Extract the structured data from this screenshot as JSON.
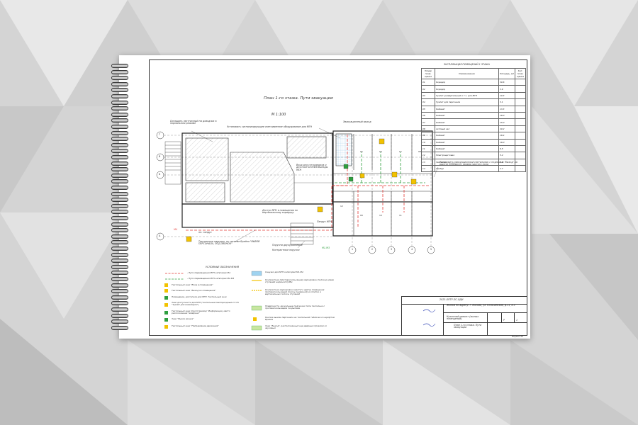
{
  "page_title": "План 1-го этажа. Пути эвакуации",
  "scale": "М 1:100",
  "explication": {
    "title": "ЭКСПЛИКАЦИЯ ПОМЕЩЕНИЙ 1 ЭТАЖА",
    "headers": [
      "Номер поме- щения",
      "Наименование",
      "Площадь, м2",
      "Кат. поме- щения"
    ],
    "rows": [
      [
        "01",
        "Коридор",
        "30.6",
        ""
      ],
      [
        "02",
        "Коридор",
        "3.9",
        ""
      ],
      [
        "03",
        "Туалет универсальный и т.ч. для МГН",
        "10.3",
        ""
      ],
      [
        "04",
        "Туалет для персонала",
        "3.1",
        ""
      ],
      [
        "05",
        "Кабинет",
        "13.3",
        ""
      ],
      [
        "06",
        "Кабинет",
        "16.0",
        ""
      ],
      [
        "07",
        "Кабинет",
        "15.0",
        ""
      ],
      [
        "08",
        "Актовый зал",
        "20.2",
        ""
      ],
      [
        "09",
        "Кабинет",
        "16.4",
        ""
      ],
      [
        "10",
        "Кабинет",
        "16.0",
        ""
      ],
      [
        "11",
        "Кабинет",
        "9.5",
        ""
      ],
      [
        "12",
        "Электрощитовая",
        "5.4",
        ""
      ],
      [
        "13",
        "Лестница",
        "8.5",
        ""
      ],
      [
        "14",
        "Тамбур",
        "2.7",
        ""
      ]
    ]
  },
  "annotations": {
    "door_note": "Оснащать лестничный на доводчик в нормальном режиме",
    "signal_note": "Установить сигнализирующее светоименное оборудование для МГН",
    "evac_exit": "Эвакуационный выход",
    "entrance_note": "Вход для сотрудников и для посетителей Выезды МГН",
    "right_note": "Установить эвакуационный светильник с подписью 'Выход' на высоте 2000мм от уровня чистого пола",
    "mgn_access": "Доступ МГН в помещения по вертикальному коридору",
    "ramp": "Пандус МГН",
    "tactile_1": "Тактильные надписи, по системе Брайля \"ВЫЗОВ ПЕРСОНАЛА, ПОД ЗВОНОК\"",
    "handrail": "Поручни двухуровневые",
    "handrail_2": "Контрастные поручни",
    "ramp_mark": "пп. пандус",
    "axis_letters": [
      "Г",
      "В",
      "Б",
      "А"
    ],
    "axis_numbers": [
      "1",
      "2",
      "3",
      "4",
      "5",
      "6"
    ],
    "route_label_red": "М4",
    "route_label_green": "М1-М3"
  },
  "legend": {
    "title": "УСЛОВНЫЕ ОБОЗНАЧЕНИЯ",
    "left": [
      "- Пути перемещения МГН категории М4",
      "- Пути перемещения МГН категории М1-М3",
      "Тактильный знак \"Вход в помещение\"",
      "Тактильный знак \"Выход из помещения\"",
      "Помещение, доступное для МГН. Тактильный знак",
      "Знак доступности для МГН (тактильный светодиодный 2.5 ГК \"Туалет для инвалидов\")",
      "Тактильный знак (пиктограмма) \"Информация, место расположения телефона\"",
      "Знак \"Вызов звонка\"",
      "Тактильный знак \"Направление движения\""
    ],
    "right": [
      "Санузел для МГН категорий М1-М4",
      "Контрастная (противоскользящая) маркировка (полосы) краев ступеней шириной 0,08м",
      "Контрастная маркировка (желтого цвета) помещения противоскользящей полосы (шириной) из плитки и вертикальных полосы ступеней",
      "Поверхности, визуальные подсказки типа тактильно с противоскользящим покрытием",
      "Кнопка вызова персонала на тактильной табличке со шрифтом Брайля",
      "Знак \"Выход\", расположенный над дверным проемом со звуковым"
    ]
  },
  "stamp": {
    "code": "2023-ОПТР-ПС-ОДИ",
    "address": "Жилой по адресу: г. Москва, ул. Кольчинская, д.11, к.3",
    "section": "Кухонный ремонт (жилых помещений)",
    "stage": "Р",
    "sheet": "1",
    "drawing": "План 1-го этажа. Пути эвакуации",
    "format": "Формат А3"
  },
  "colors": {
    "red_route": "#e53935",
    "green_route": "#2e9e3e",
    "blue_fill": "#9fd3f0",
    "yellow": "#f2c200"
  }
}
